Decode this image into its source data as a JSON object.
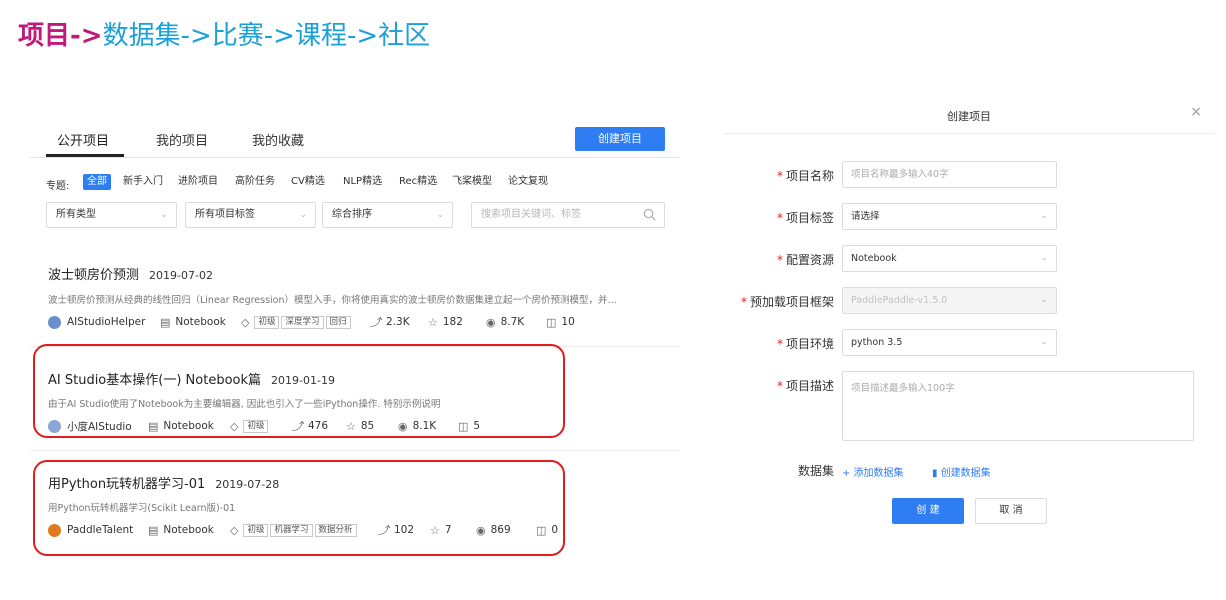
{
  "banner": {
    "active": "项目",
    "arrow": "->",
    "crumbs": [
      "数据集",
      "->",
      "比赛",
      "->",
      "课程",
      "->",
      "社区"
    ]
  },
  "tabs": {
    "public": "公开项目",
    "mine": "我的项目",
    "favorites": "我的收藏",
    "create": "创建项目"
  },
  "topics": {
    "label": "专题:",
    "items": [
      "全部",
      "新手入门",
      "进阶项目",
      "高阶任务",
      "CV精选",
      "NLP精选",
      "Rec精选",
      "飞桨模型",
      "论文复现"
    ]
  },
  "filters": {
    "type": "所有类型",
    "tags": "所有项目标签",
    "sort": "综合排序",
    "search_placeholder": "搜索项目关键词、标签"
  },
  "projects": [
    {
      "title": "波士顿房价预测",
      "date": "2019-07-02",
      "desc": "波士顿房价预测从经典的线性回归（Linear Regression）模型入手，你将使用真实的波士顿房价数据集建立起一个房价预测模型，并…",
      "author": "AIStudioHelper",
      "kind": "Notebook",
      "tags": [
        "初级",
        "深度学习",
        "回归"
      ],
      "forks": "2.3K",
      "stars": "182",
      "views": "8.7K",
      "comments": "10"
    },
    {
      "title": "AI Studio基本操作(一) Notebook篇",
      "date": "2019-01-19",
      "desc": "由于AI Studio使用了Notebook为主要编辑器, 因此也引入了一些iPython操作. 特别示例说明",
      "author": "小度AIStudio",
      "kind": "Notebook",
      "tags": [
        "初级"
      ],
      "forks": "476",
      "stars": "85",
      "views": "8.1K",
      "comments": "5"
    },
    {
      "title": "用Python玩转机器学习-01",
      "date": "2019-07-28",
      "desc": "用Python玩转机器学习(Scikit Learn版)-01",
      "author": "PaddleTalent",
      "kind": "Notebook",
      "tags": [
        "初级",
        "机器学习",
        "数据分析"
      ],
      "forks": "102",
      "stars": "7",
      "views": "869",
      "comments": "0"
    }
  ],
  "modal": {
    "title": "创建项目",
    "close": "×",
    "required_mark": "*",
    "fields": {
      "name_label": "项目名称",
      "name_placeholder": "项目名称最多输入40字",
      "tag_label": "项目标签",
      "tag_value": "请选择",
      "resource_label": "配置资源",
      "resource_value": "Notebook",
      "framework_label": "预加载项目框架",
      "framework_value": "PaddlePaddle-v1.5.0",
      "env_label": "项目环境",
      "env_value": "python 3.5",
      "desc_label": "项目描述",
      "desc_placeholder": "项目描述最多输入100字"
    },
    "dataset_label": "数据集",
    "add_dataset": "+ 添加数据集",
    "create_dataset": "创建数据集",
    "submit": "创 建",
    "cancel": "取 消"
  },
  "colors": {
    "banner_active": "#c2187a",
    "banner_crumb": "#1ba0d9",
    "primary": "#2f7df3",
    "highlight": "#e01c1c"
  }
}
